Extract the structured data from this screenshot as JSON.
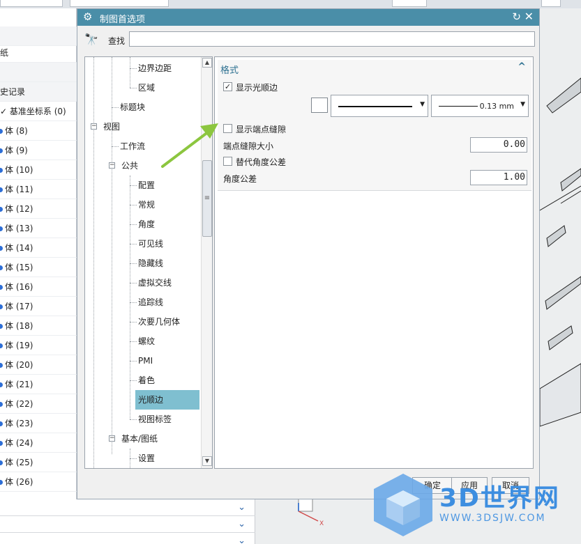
{
  "dialog": {
    "title": "制图首选项",
    "find_label": "查找",
    "find_value": ""
  },
  "nav_panel": {
    "items": [
      "纸",
      "史记录",
      "基准坐标系 (0)",
      "体 (8)",
      "体 (9)",
      "体 (10)",
      "体 (11)",
      "体 (12)",
      "体 (13)",
      "体 (14)",
      "体 (15)",
      "体 (16)",
      "体 (17)",
      "体 (18)",
      "体 (19)",
      "体 (20)",
      "体 (21)",
      "体 (22)",
      "体 (23)",
      "体 (24)",
      "体 (25)",
      "体 (26)"
    ]
  },
  "tree": {
    "items": [
      {
        "label": "边界边距"
      },
      {
        "label": "区域"
      },
      {
        "label": "标题块"
      },
      {
        "label": "视图"
      },
      {
        "label": "工作流"
      },
      {
        "label": "公共"
      },
      {
        "label": "配置"
      },
      {
        "label": "常规"
      },
      {
        "label": "角度"
      },
      {
        "label": "可见线"
      },
      {
        "label": "隐藏线"
      },
      {
        "label": "虚拟交线"
      },
      {
        "label": "追踪线"
      },
      {
        "label": "次要几何体"
      },
      {
        "label": "螺纹"
      },
      {
        "label": "PMI"
      },
      {
        "label": "着色"
      },
      {
        "label": "光顺边"
      },
      {
        "label": "视图标签"
      },
      {
        "label": "基本/图纸"
      },
      {
        "label": "设置"
      }
    ],
    "selected": "光顺边"
  },
  "format_section": {
    "title": "格式",
    "show_smooth_edges": {
      "label": "显示光顺边",
      "checked": true
    },
    "line_width": "0.13 mm",
    "show_end_gap": {
      "label": "显示端点缝隙",
      "checked": false
    },
    "end_gap_size": {
      "label": "端点缝隙大小",
      "value": "0.00"
    },
    "alt_angle_tol": {
      "label": "替代角度公差",
      "checked": false
    },
    "angle_tol": {
      "label": "角度公差",
      "value": "1.00"
    }
  },
  "buttons": {
    "ok": "确定",
    "apply": "应用",
    "cancel": "取消"
  },
  "watermark": {
    "title": "3D世界网",
    "url": "WWW.3DSJW.COM"
  },
  "colors": {
    "titlebar": "#4a8ea8",
    "selected_row": "#7fbfd0",
    "arrow": "#8cc63f",
    "section_title": "#2e7191"
  }
}
